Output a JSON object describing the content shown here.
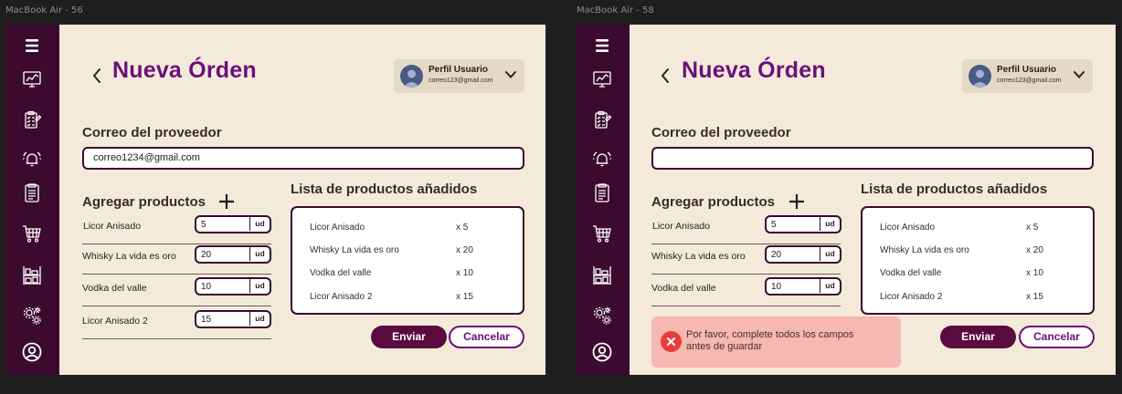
{
  "colors": {
    "sidebar": "#3b0a2e",
    "title": "#6b0f7d",
    "background": "#f4ead9",
    "send_button": "#5a0a3e",
    "error_bg": "#f6b8b0",
    "error_icon": "#e83c3c"
  },
  "sidebar_icons": [
    "menu-icon",
    "dashboard-monitor-icon",
    "clipboard-checklist-icon",
    "alarm-bell-icon",
    "document-list-icon",
    "shopping-cart-icon",
    "warehouse-shelf-icon",
    "gears-settings-icon",
    "user-account-icon"
  ],
  "frames": [
    {
      "frame_label": "MacBook Air - 56",
      "title": "Nueva Órden",
      "profile": {
        "name": "Perfil Usuario",
        "email": "correo123@gmail.com"
      },
      "supplier_label": "Correo del proveedor",
      "supplier_email": "correo1234@gmail.com",
      "add_products_label": "Agregar productos",
      "products": [
        {
          "name": "Licor Anisado",
          "qty": "5",
          "unit": "ud"
        },
        {
          "name": "Whisky La vida es oro",
          "qty": "20",
          "unit": "ud"
        },
        {
          "name": "Vodka del valle",
          "qty": "10",
          "unit": "ud"
        },
        {
          "name": "Licor Anisado 2",
          "qty": "15",
          "unit": "ud"
        }
      ],
      "list_title": "Lista de productos añadidos",
      "list_items": [
        {
          "name": "Licor Anisado",
          "qty": "x 5"
        },
        {
          "name": "Whisky La vida es oro",
          "qty": "x 20"
        },
        {
          "name": "Vodka del valle",
          "qty": "x 10"
        },
        {
          "name": "Licor Anisado 2",
          "qty": "x 15"
        }
      ],
      "send_label": "Enviar",
      "cancel_label": "Cancelar"
    },
    {
      "frame_label": "MacBook Air - 58",
      "title": "Nueva Órden",
      "profile": {
        "name": "Perfil Usuario",
        "email": "correo123@gmail.com"
      },
      "supplier_label": "Correo del proveedor",
      "supplier_email": "",
      "add_products_label": "Agregar productos",
      "products": [
        {
          "name": "Licor Anisado",
          "qty": "5",
          "unit": "ud"
        },
        {
          "name": "Whisky La vida es oro",
          "qty": "20",
          "unit": "ud"
        },
        {
          "name": "Vodka del valle",
          "qty": "10",
          "unit": "ud"
        }
      ],
      "list_title": "Lista de productos añadidos",
      "list_items": [
        {
          "name": "Licor Anisado",
          "qty": "x 5"
        },
        {
          "name": "Whisky La vida es oro",
          "qty": "x 20"
        },
        {
          "name": "Vodka del valle",
          "qty": "x 10"
        },
        {
          "name": "Licor Anisado 2",
          "qty": "x 15"
        }
      ],
      "error_message": "Por favor, complete todos los campos antes de guardar",
      "send_label": "Enviar",
      "cancel_label": "Cancelar"
    }
  ]
}
